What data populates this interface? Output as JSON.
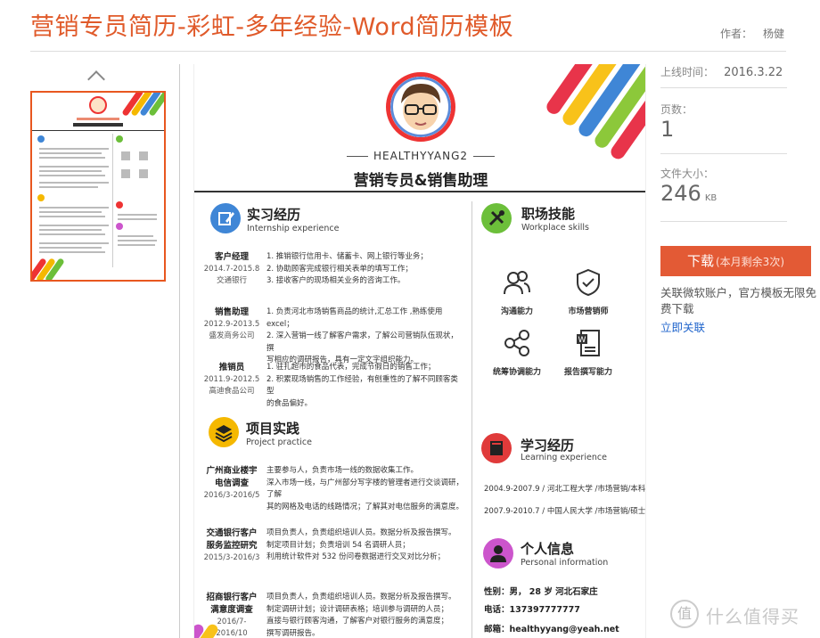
{
  "page": {
    "title": "营销专员简历-彩虹-多年经验-Word简历模板",
    "author_label": "作者：",
    "author_name": "杨健"
  },
  "meta": {
    "online_label": "上线时间：",
    "online_value": "2016.3.22",
    "pages_label": "页数：",
    "pages_value": "1",
    "size_label": "文件大小：",
    "size_value": "246",
    "size_unit": "KB"
  },
  "download": {
    "label": "下载",
    "remaining": "(本月剩余3次)"
  },
  "note": {
    "text": "关联微软账户，官方模板无限免费下载",
    "link": "立即关联"
  },
  "watermark": {
    "icon_text": "值",
    "text": "什么值得买"
  },
  "resume": {
    "name": "HEALTHYYANG2",
    "role": "营销专员&销售助理",
    "sections": {
      "intern": {
        "title": "实习经历",
        "sub": "Internship experience",
        "color": "#3f86d6"
      },
      "project": {
        "title": "项目实践",
        "sub": "Project practice",
        "color": "#f5b800"
      },
      "skills": {
        "title": "职场技能",
        "sub": "Workplace skills",
        "color": "#6cbf3a"
      },
      "study": {
        "title": "学习经历",
        "sub": "Learning experience",
        "color": "#e03a3a"
      },
      "personal": {
        "title": "个人信息",
        "sub": "Personal information",
        "color": "#cc55cc"
      }
    },
    "jobs": [
      {
        "title": "客户经理",
        "date": "2014.7-2015.8",
        "company": "交通银行",
        "lines": [
          "1. 推销银行信用卡、储蓄卡、网上银行等业务；",
          "2. 协助顾客完成银行相关表单的填写工作；",
          "3. 接收客户的现场相关业务的咨询工作。"
        ]
      },
      {
        "title": "销售助理",
        "date": "2012.9-2013.5",
        "company": "盛发商务公司",
        "lines": [
          "1. 负责河北市场销售商品的统计,汇总工作 ,熟练使用 excel；",
          "2. 深入营销一线了解客户需求，了解公司营销队伍现状，撰",
          "写相应的调研报告，具有一定文字组织能力。"
        ]
      },
      {
        "title": "推销员",
        "date": "2011.9-2012.5",
        "company": "高迪食品公司",
        "lines": [
          "1. 驻扎超市的食品代表，完成节假日的销售工作；",
          "2. 积累现场销售的工作经验，有刨重性的了解不同顾客类型",
          "的食品偏好。"
        ]
      }
    ],
    "projects": [
      {
        "title1": "广州商业楼宇",
        "title2": "电信调查",
        "date": "2016/3-2016/5",
        "lines": [
          "主要参与人，负责市场一线的数据收集工作。",
          "深入市场一线，与广州部分写字楼的管理者进行交谈调研，了解",
          "其的网格及电话的线路情况；了解其对电信服务的满意度。"
        ]
      },
      {
        "title1": "交通银行客户",
        "title2": "服务监控研究",
        "date": "2015/3-2016/3",
        "lines": [
          "项目负责人，负责组织培训人员。数据分析及报告撰写。",
          "制定项目计划；负责培训 54 名调研人员；",
          "利用统计软件对 532 份问卷数据进行交叉对比分析；"
        ]
      },
      {
        "title1": "招商银行客户",
        "title2": "满意度调查",
        "date": "2016/7-2016/10",
        "lines": [
          "项目负责人，负责组织培训人员。数据分析及报告撰写。",
          "制定调研计划；设计调研表格；培训参与调研的人员；",
          "直接与银行顾客沟通，了解客户对银行服务的满意度；",
          "撰写调研报告。"
        ]
      }
    ],
    "skills": [
      {
        "icon": "people-icon",
        "label": "沟通能力"
      },
      {
        "icon": "shield-check-icon",
        "label": "市场营销师"
      },
      {
        "icon": "share-icon",
        "label": "统筹协调能力"
      },
      {
        "icon": "word-doc-icon",
        "label": "报告撰写能力"
      }
    ],
    "education": [
      "2004.9-2007.9 / 河北工程大学 /市场营销/本科",
      "2007.9-2010.7 / 中国人民大学 /市场营销/硕士"
    ],
    "personal": {
      "line1": "性别：男， 28 岁  河北石家庄",
      "phone_label": "电话：",
      "phone": "137397777777",
      "email_label": "邮箱：",
      "email": "healthyyang@yeah.net"
    }
  }
}
